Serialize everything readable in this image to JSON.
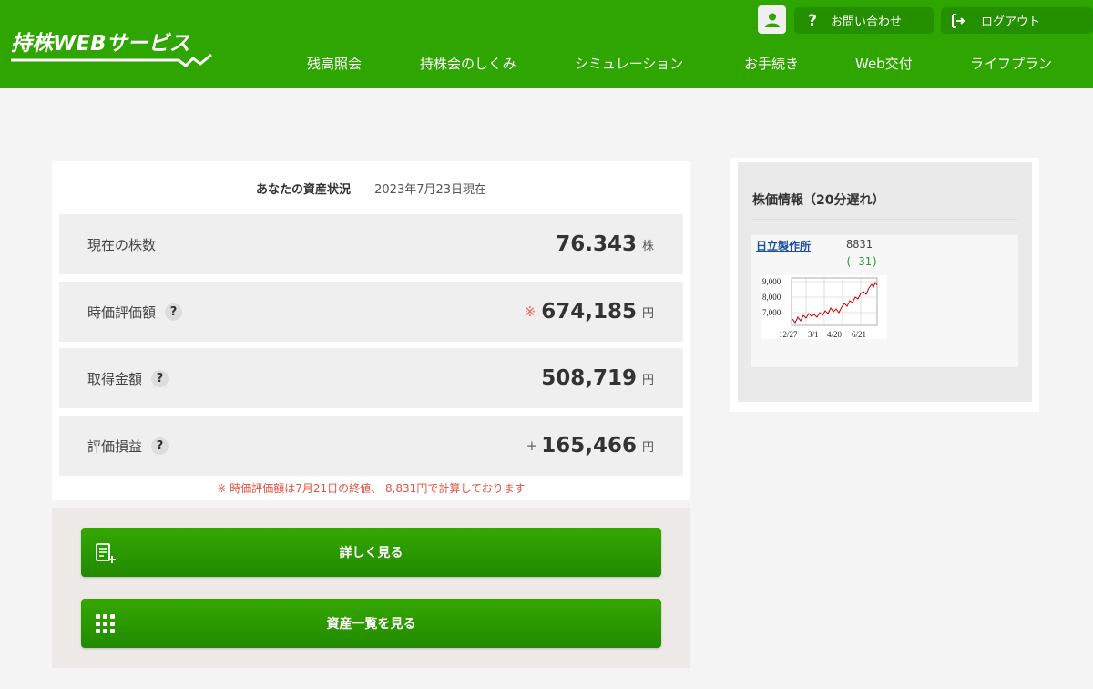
{
  "header": {
    "logo_text": "持株WEBサービス",
    "contact_label": "お問い合わせ",
    "logout_label": "ログアウト",
    "nav": [
      "残高照会",
      "持株会のしくみ",
      "シミュレーション",
      "お手続き",
      "Web交付",
      "ライフプラン"
    ]
  },
  "summary": {
    "title": "あなたの資産状況",
    "date": "2023年7月23日現在",
    "rows": [
      {
        "label": "現在の株数",
        "mark": "",
        "value": "76.343",
        "unit": "株",
        "help": false
      },
      {
        "label": "時価評価額",
        "mark": "※",
        "value": "674,185",
        "unit": "円",
        "help": true
      },
      {
        "label": "取得金額",
        "mark": "",
        "value": "508,719",
        "unit": "円",
        "help": true
      },
      {
        "label": "評価損益",
        "mark": "+",
        "value": "165,466",
        "unit": "円",
        "help": true
      }
    ],
    "help_symbol": "?",
    "note": "※ 時価評価額は7月21日の終値、 8,831円で計算しております"
  },
  "buttons": {
    "detail_label": "詳しく見る",
    "assets_label": "資産一覧を見る"
  },
  "stock": {
    "title": "株価情報（20分遅れ）",
    "company": "日立製作所",
    "code": "8831",
    "change": "(-31)",
    "chart": {
      "y_ticks": [
        "9,000",
        "8,000",
        "7,000"
      ],
      "x_ticks": [
        "12/27",
        "3/1",
        "4/20",
        "6/21"
      ],
      "line_color": "#cc0000"
    }
  },
  "colors": {
    "brand_green": "#2ea500",
    "note_red": "#e4533f",
    "change_green": "#2a9a2a"
  }
}
